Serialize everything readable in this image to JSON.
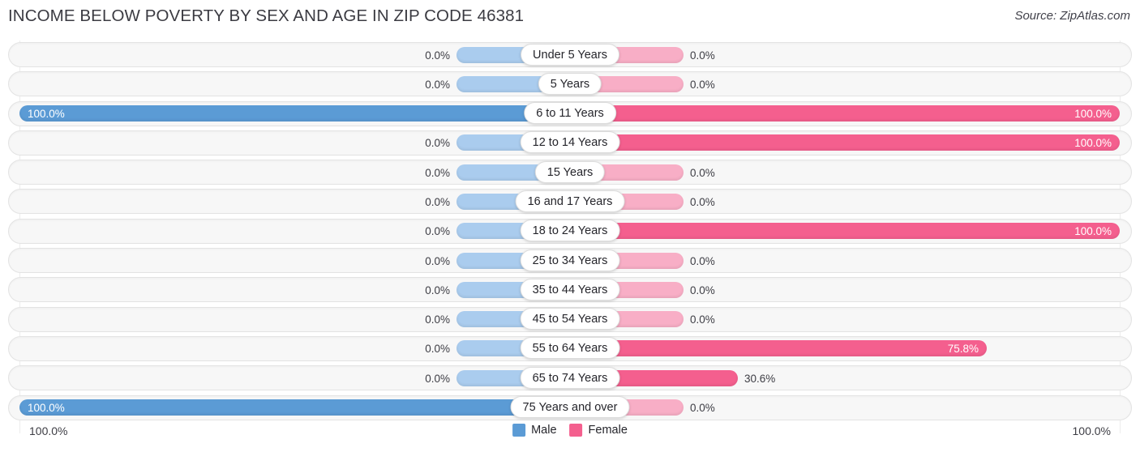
{
  "header": {
    "title": "INCOME BELOW POVERTY BY SEX AND AGE IN ZIP CODE 46381",
    "source": "Source: ZipAtlas.com"
  },
  "footer": {
    "axis_left": "100.0%",
    "axis_right": "100.0%",
    "legend": [
      {
        "label": "Male",
        "color": "#5b9bd5"
      },
      {
        "label": "Female",
        "color": "#f45f8e"
      }
    ]
  },
  "colors": {
    "male_strong": "#5b9bd5",
    "male_stub": "#aaccee",
    "female_strong": "#f45f8e",
    "female_stub": "#f8aec6",
    "track": "#f7f7f7",
    "track_border": "#e3e3e3",
    "text": "#3d3d44",
    "text_inverse": "#ffffff"
  },
  "chart_data": {
    "type": "bar",
    "subtype": "diverging-horizontal",
    "title": "INCOME BELOW POVERTY BY SEX AND AGE IN ZIP CODE 46381",
    "xlabel": "",
    "ylabel": "",
    "xlim": [
      0,
      100
    ],
    "unit": "%",
    "grid": false,
    "legend_position": "bottom-center",
    "categories": [
      "Under 5 Years",
      "5 Years",
      "6 to 11 Years",
      "12 to 14 Years",
      "15 Years",
      "16 and 17 Years",
      "18 to 24 Years",
      "25 to 34 Years",
      "35 to 44 Years",
      "45 to 54 Years",
      "55 to 64 Years",
      "65 to 74 Years",
      "75 Years and over"
    ],
    "series": [
      {
        "name": "Male",
        "direction": "left",
        "color": "#5b9bd5",
        "values": [
          0.0,
          0.0,
          100.0,
          0.0,
          0.0,
          0.0,
          0.0,
          0.0,
          0.0,
          0.0,
          0.0,
          0.0,
          100.0
        ]
      },
      {
        "name": "Female",
        "direction": "right",
        "color": "#f45f8e",
        "values": [
          0.0,
          0.0,
          100.0,
          100.0,
          0.0,
          0.0,
          100.0,
          0.0,
          0.0,
          0.0,
          75.8,
          30.6,
          0.0
        ]
      }
    ]
  },
  "rows": [
    {
      "label": "Under 5 Years",
      "male": "0.0%",
      "male_value": 0.0,
      "female": "0.0%",
      "female_value": 0.0
    },
    {
      "label": "5 Years",
      "male": "0.0%",
      "male_value": 0.0,
      "female": "0.0%",
      "female_value": 0.0
    },
    {
      "label": "6 to 11 Years",
      "male": "100.0%",
      "male_value": 100.0,
      "female": "100.0%",
      "female_value": 100.0
    },
    {
      "label": "12 to 14 Years",
      "male": "0.0%",
      "male_value": 0.0,
      "female": "100.0%",
      "female_value": 100.0
    },
    {
      "label": "15 Years",
      "male": "0.0%",
      "male_value": 0.0,
      "female": "0.0%",
      "female_value": 0.0
    },
    {
      "label": "16 and 17 Years",
      "male": "0.0%",
      "male_value": 0.0,
      "female": "0.0%",
      "female_value": 0.0
    },
    {
      "label": "18 to 24 Years",
      "male": "0.0%",
      "male_value": 0.0,
      "female": "100.0%",
      "female_value": 100.0
    },
    {
      "label": "25 to 34 Years",
      "male": "0.0%",
      "male_value": 0.0,
      "female": "0.0%",
      "female_value": 0.0
    },
    {
      "label": "35 to 44 Years",
      "male": "0.0%",
      "male_value": 0.0,
      "female": "0.0%",
      "female_value": 0.0
    },
    {
      "label": "45 to 54 Years",
      "male": "0.0%",
      "male_value": 0.0,
      "female": "0.0%",
      "female_value": 0.0
    },
    {
      "label": "55 to 64 Years",
      "male": "0.0%",
      "male_value": 0.0,
      "female": "75.8%",
      "female_value": 75.8
    },
    {
      "label": "65 to 74 Years",
      "male": "0.0%",
      "male_value": 0.0,
      "female": "30.6%",
      "female_value": 30.6
    },
    {
      "label": "75 Years and over",
      "male": "100.0%",
      "male_value": 100.0,
      "female": "0.0%",
      "female_value": 0.0
    }
  ]
}
